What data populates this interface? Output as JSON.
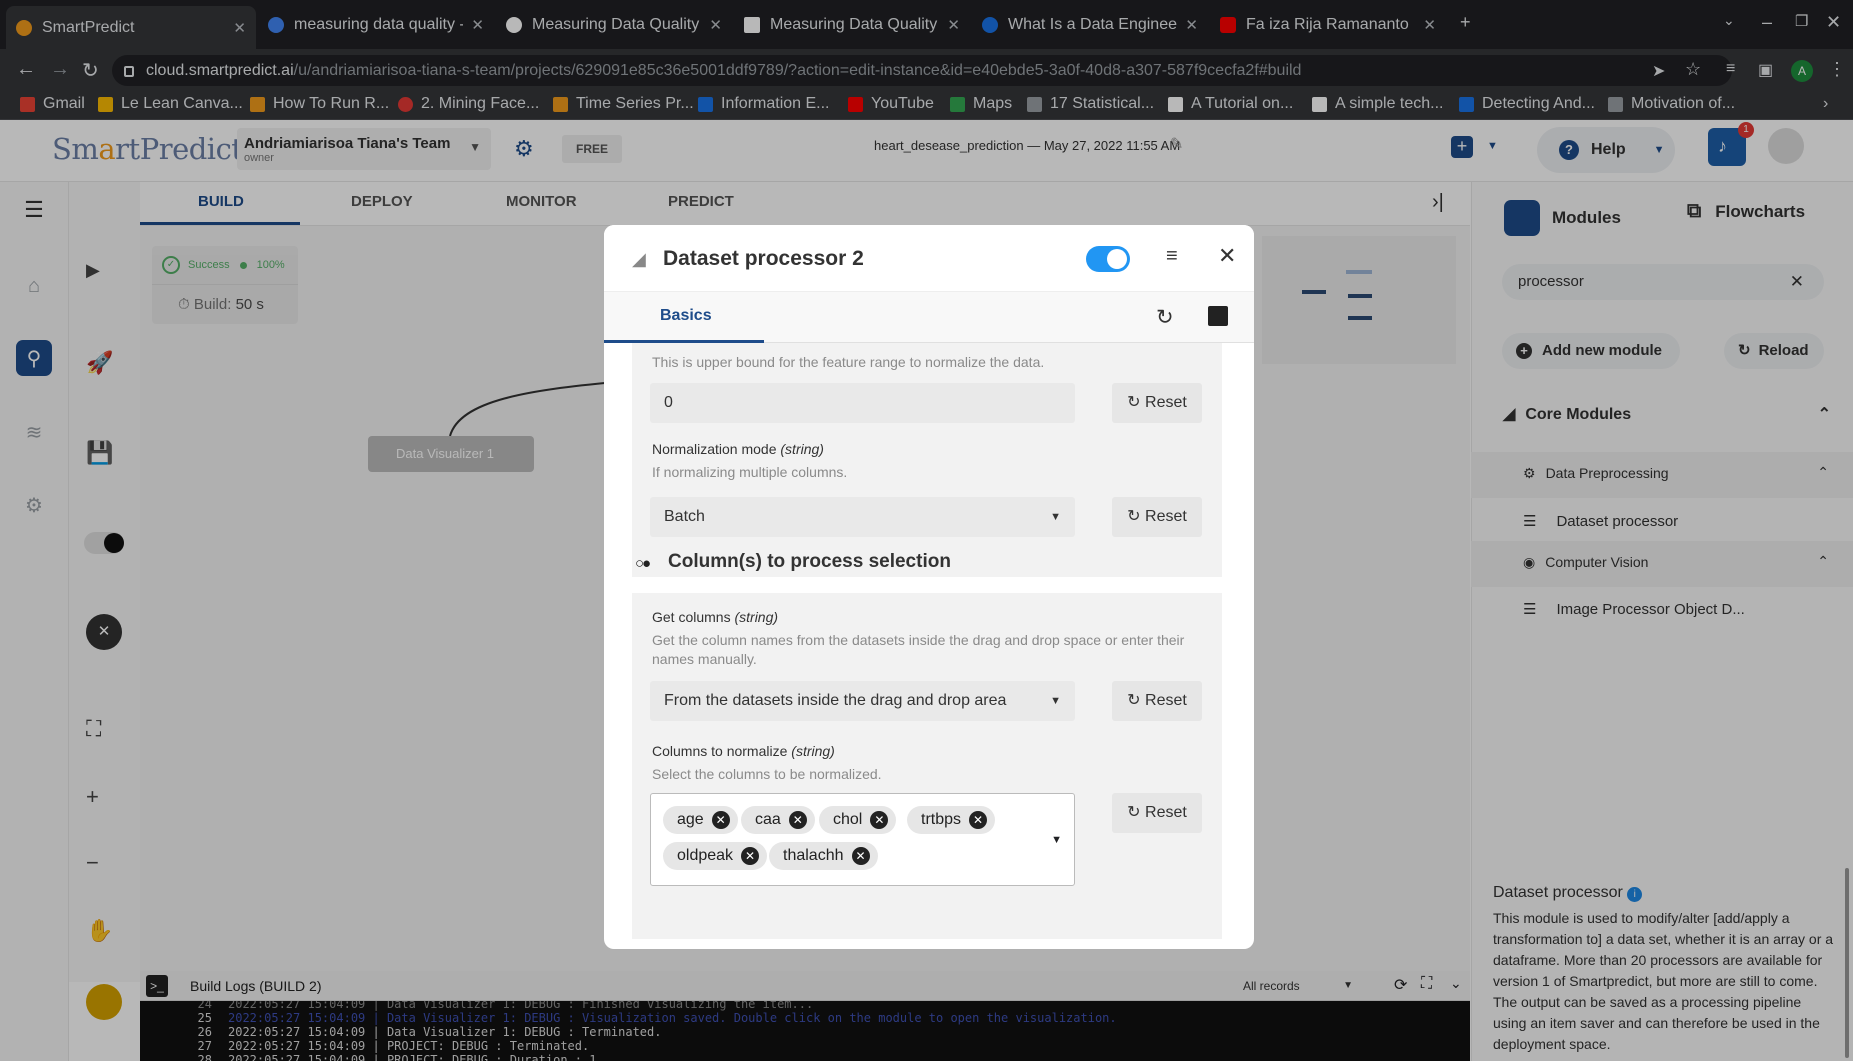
{
  "browser": {
    "tabs": [
      {
        "title": "SmartPredict",
        "favicon_color": "#f29b1c"
      },
      {
        "title": "measuring data quality - G",
        "favicon_color": "#4285f4"
      },
      {
        "title": "Measuring Data Quality fo",
        "favicon_color": "#ffffff"
      },
      {
        "title": "Measuring Data Quality fo",
        "favicon_color": "#ffffff"
      },
      {
        "title": "What Is a Data Engineer?",
        "favicon_color": "#1a73e8"
      },
      {
        "title": "Fa iza Rija Ramananto",
        "favicon_color": "#ff0000"
      }
    ],
    "url_host": "cloud.smartpredict.ai",
    "url_path": "/u/andriamiarisoa-tiana-s-team/projects/629091e85c36e5001ddf9789/?action=edit-instance&id=e40ebde5-3a0f-40d8-a307-587f9cecfa2f#build",
    "bookmarks": [
      "Gmail",
      "Le Lean Canva...",
      "How To Run R...",
      "2. Mining Face...",
      "Time Series Pr...",
      "Information E...",
      "YouTube",
      "Maps",
      "17 Statistical...",
      "A Tutorial on...",
      "A simple tech...",
      "Detecting And...",
      "Motivation of..."
    ]
  },
  "app": {
    "logo_pre": "Sm",
    "logo_a": "a",
    "logo_post": "rtPredict",
    "team_name": "Andriamiarisoa Tiana's Team",
    "team_role": "owner",
    "plan": "FREE",
    "project": "heart_desease_prediction — May 27, 2022 11:55 AM",
    "help": "Help",
    "notifications": "1"
  },
  "workspace_tabs": [
    "BUILD",
    "DEPLOY",
    "MONITOR",
    "PREDICT"
  ],
  "build_status": {
    "label": "Success",
    "percent": "100%",
    "build_label": "Build:",
    "build_time": "50 s"
  },
  "canvas_node": "Data Visualizer 1",
  "modal": {
    "title": "Dataset processor 2",
    "tab": "Basics",
    "upper_hint": "This is upper bound for the feature range to normalize the data.",
    "upper_value": "0",
    "reset": "Reset",
    "norm_mode_label": "Normalization mode",
    "norm_mode_type": "(string)",
    "norm_mode_hint": "If normalizing multiple columns.",
    "norm_mode_value": "Batch",
    "section_title": "Column(s) to process selection",
    "get_cols_label": "Get columns",
    "get_cols_type": "(string)",
    "get_cols_hint": "Get the column names from the datasets inside the drag and drop space or enter their names manually.",
    "get_cols_value": "From the datasets inside the drag and drop area",
    "cols_label": "Columns to normalize",
    "cols_type": "(string)",
    "cols_hint": "Select the columns to be normalized.",
    "columns": [
      "age",
      "caa",
      "chol",
      "trtbps",
      "oldpeak",
      "thalachh"
    ]
  },
  "right_panel": {
    "tab_modules": "Modules",
    "tab_flowcharts": "Flowcharts",
    "search": "processor",
    "add_module": "Add new module",
    "reload": "Reload",
    "core": "Core Modules",
    "cat1": "Data Preprocessing",
    "item1": "Dataset processor",
    "cat2": "Computer Vision",
    "item2": "Image Processor Object D...",
    "desc_title": "Dataset processor",
    "desc_text": "This module is used to modify/alter [add/apply a transformation to] a data set, whether it is an array or a dataframe. More than 20 processors are available for version 1 of Smartpredict, but more are still to come. The output can be saved as a processing pipeline using an item saver and can therefore be used in the deployment space."
  },
  "logs": {
    "title": "Build Logs (BUILD 2)",
    "filter": "All records",
    "lines": [
      {
        "n": "24",
        "t": "2022:05:27 15:04:09 | Data Visualizer 1: DEBUG : Finished visualizing the item..."
      },
      {
        "n": "25",
        "t": "2022:05:27 15:04:09 | Data Visualizer 1: DEBUG : Visualization saved. Double click on the module to open the visualization."
      },
      {
        "n": "26",
        "t": "2022:05:27 15:04:09 | Data Visualizer 1: DEBUG : Terminated."
      },
      {
        "n": "27",
        "t": "2022:05:27 15:04:09 | PROJECT: DEBUG : Terminated."
      },
      {
        "n": "28",
        "t": "2022:05:27 15:04:09 | PROJECT: DEBUG : Duration : 1"
      }
    ]
  }
}
